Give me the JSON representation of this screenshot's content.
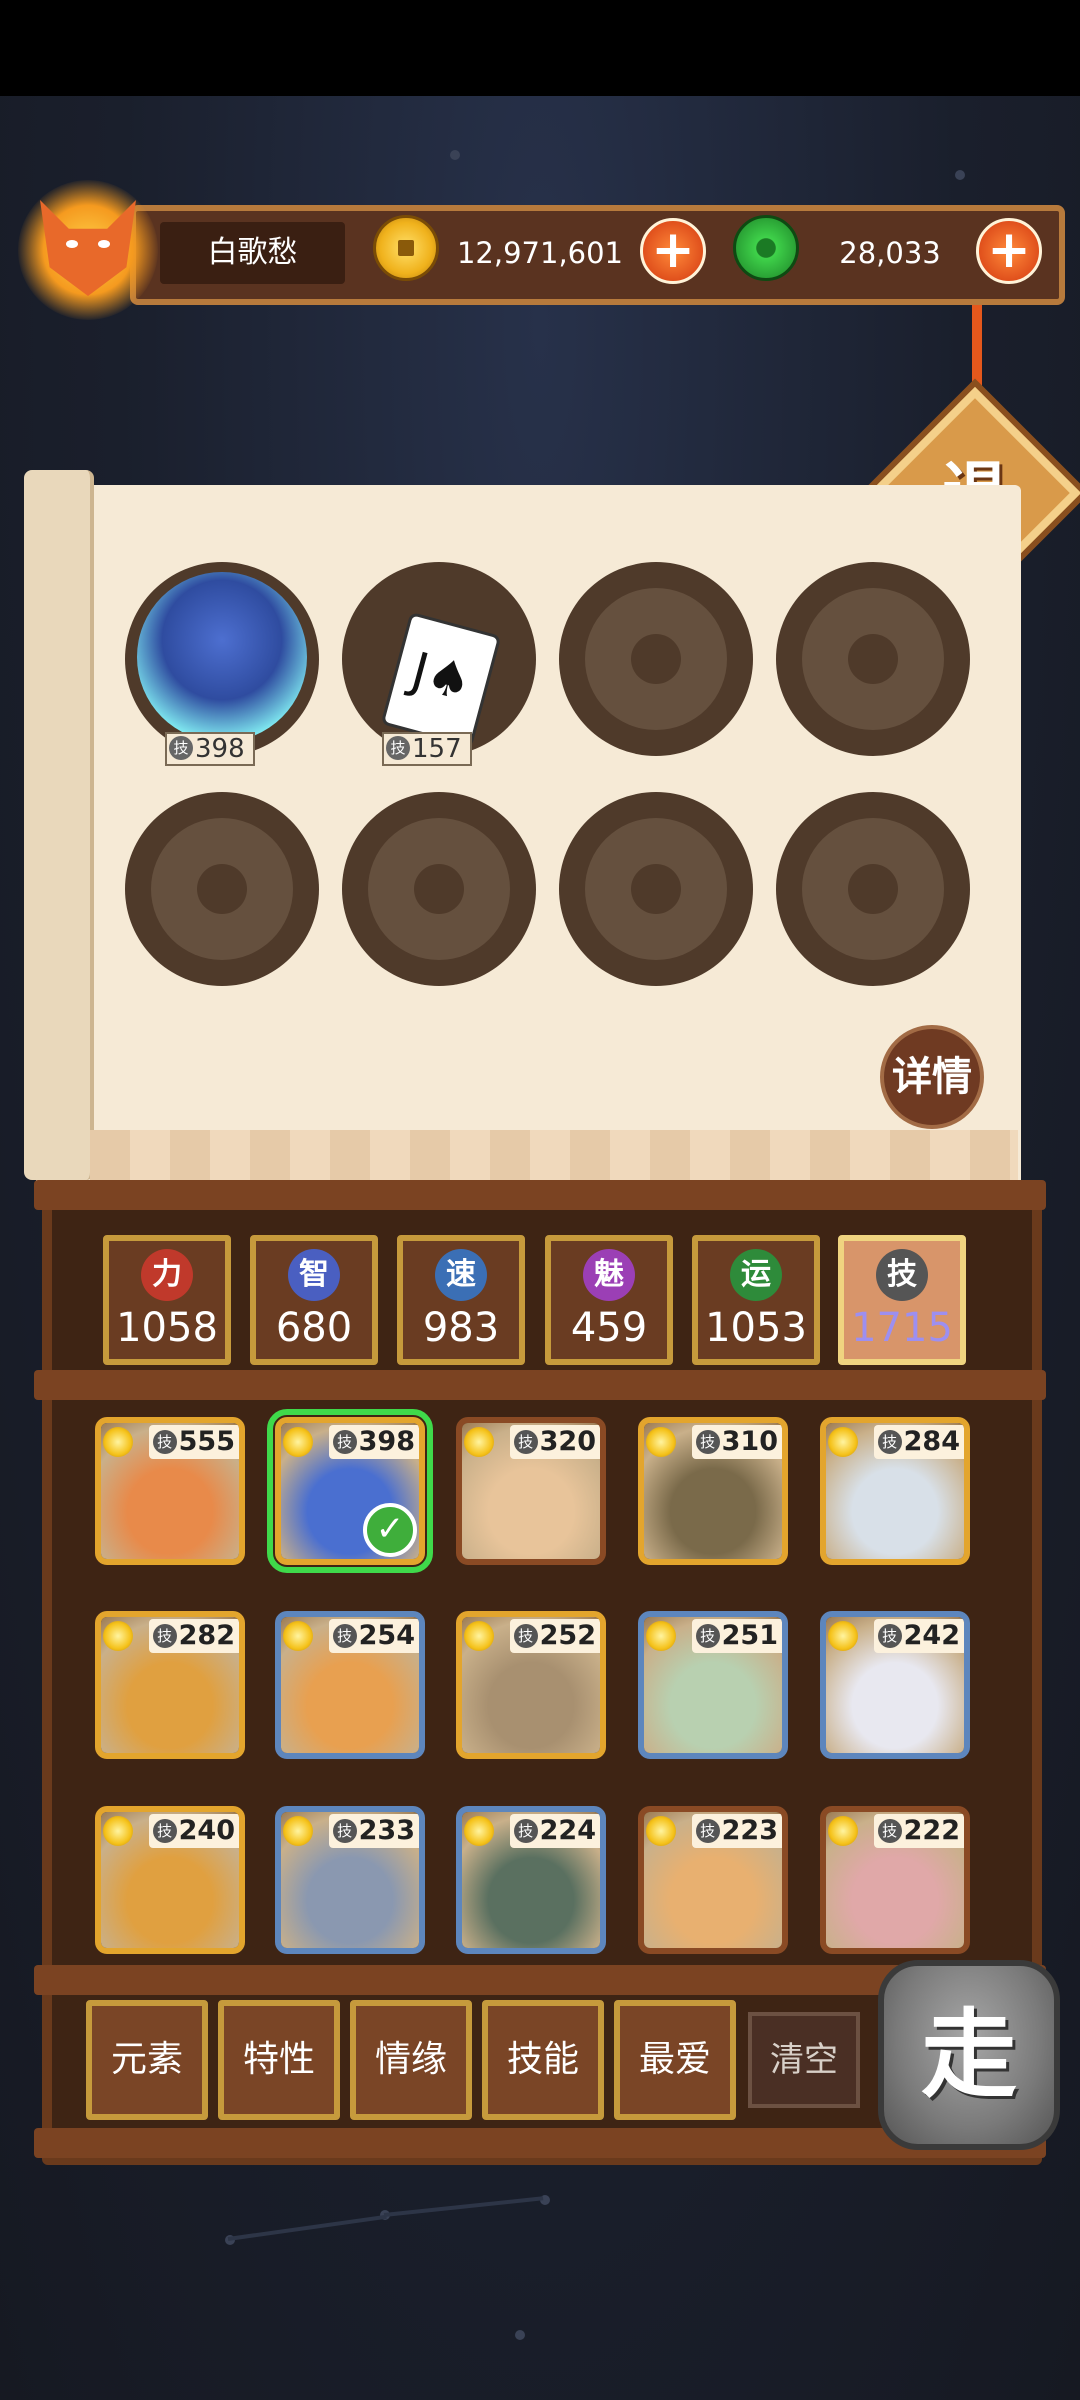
{
  "player": {
    "name": "白歌愁"
  },
  "currencies": {
    "coins": {
      "value": "12,971,601",
      "icon": "coin-icon"
    },
    "jade": {
      "value": "28,033",
      "icon": "jade-icon"
    }
  },
  "buttons": {
    "exit": "退",
    "details": "详情",
    "go": "走",
    "plus": "+"
  },
  "team_slots": [
    {
      "filled": true,
      "type": "character",
      "skill": "398",
      "skill_icon": "技"
    },
    {
      "filled": true,
      "type": "card",
      "card_symbol": "J♠",
      "skill": "157",
      "skill_icon": "技"
    },
    {
      "filled": false
    },
    {
      "filled": false
    },
    {
      "filled": false
    },
    {
      "filled": false
    },
    {
      "filled": false
    },
    {
      "filled": false
    }
  ],
  "stats": [
    {
      "icon": "力",
      "value": "1058",
      "color": "#c0392b"
    },
    {
      "icon": "智",
      "value": "680",
      "color": "#4a5fc1"
    },
    {
      "icon": "速",
      "value": "983",
      "color": "#3b6fb5"
    },
    {
      "icon": "魅",
      "value": "459",
      "color": "#9b3fb5"
    },
    {
      "icon": "运",
      "value": "1053",
      "color": "#2e8b3a"
    },
    {
      "icon": "技",
      "value": "1715",
      "color": "#555555",
      "active": true,
      "value_color": "#9d8ff0"
    }
  ],
  "skill_icon": "技",
  "heroes": [
    {
      "skill": "555",
      "frame": "gold",
      "color": "#e88a4a"
    },
    {
      "skill": "398",
      "frame": "gold",
      "color": "#4a6fd0",
      "selected": true
    },
    {
      "skill": "320",
      "frame": "brown",
      "color": "#e8c49a"
    },
    {
      "skill": "310",
      "frame": "gold",
      "color": "#7a6a4a"
    },
    {
      "skill": "284",
      "frame": "gold",
      "color": "#d8e0e8"
    },
    {
      "skill": "282",
      "frame": "gold",
      "color": "#e0a040"
    },
    {
      "skill": "254",
      "frame": "blue",
      "color": "#e8a050"
    },
    {
      "skill": "252",
      "frame": "gold",
      "color": "#a89070"
    },
    {
      "skill": "251",
      "frame": "blue",
      "color": "#b8d0b0"
    },
    {
      "skill": "242",
      "frame": "blue",
      "color": "#e8e8f0"
    },
    {
      "skill": "240",
      "frame": "gold",
      "color": "#e0a040"
    },
    {
      "skill": "233",
      "frame": "blue",
      "color": "#8a98b0"
    },
    {
      "skill": "224",
      "frame": "blue",
      "color": "#5a7060"
    },
    {
      "skill": "223",
      "frame": "brown",
      "color": "#e8b070"
    },
    {
      "skill": "222",
      "frame": "brown",
      "color": "#e0a8a8"
    }
  ],
  "filters": [
    "元素",
    "特性",
    "情缘",
    "技能",
    "最爱"
  ],
  "clear_label": "清空"
}
